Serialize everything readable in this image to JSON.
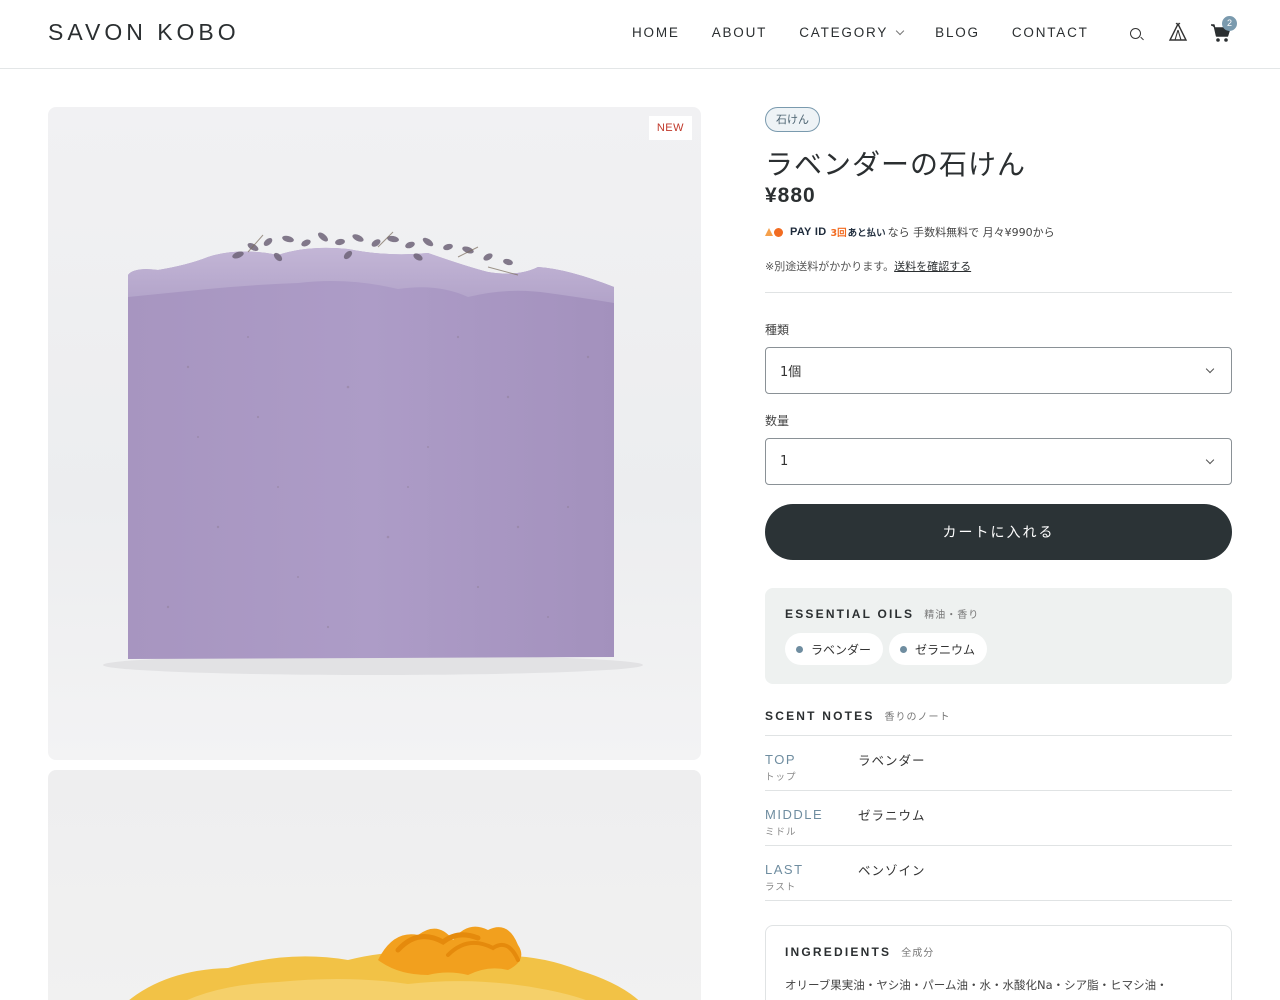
{
  "header": {
    "logo": "SAVON KOBO",
    "nav": [
      {
        "label": "HOME"
      },
      {
        "label": "ABOUT"
      },
      {
        "label": "CATEGORY"
      },
      {
        "label": "BLOG"
      },
      {
        "label": "CONTACT"
      }
    ],
    "cart_count": "2",
    "icons": [
      "search-icon",
      "tent-icon",
      "cart-icon"
    ]
  },
  "gallery": {
    "new_badge": "NEW"
  },
  "product": {
    "tag": "石けん",
    "title": "ラベンダーの石けん",
    "price": "¥880",
    "payid": {
      "brand": "PAY ID",
      "promo_a": "3回",
      "promo_b": "あと払い",
      "text": "なら 手数料無料で 月々¥990から"
    },
    "shipping": {
      "text": "※別途送料がかかります。",
      "link": "送料を確認する"
    },
    "type_field": {
      "label": "種類",
      "value": "1個"
    },
    "qty_field": {
      "label": "数量",
      "value": "1"
    },
    "cart_button": "カートに入れる"
  },
  "essential_oils": {
    "title": "ESSENTIAL OILS",
    "subtitle": "精油・香り",
    "items": [
      "ラベンダー",
      "ゼラニウム"
    ]
  },
  "scent_notes": {
    "title": "SCENT NOTES",
    "subtitle": "香りのノート",
    "rows": [
      {
        "en": "TOP",
        "jp": "トップ",
        "value": "ラベンダー"
      },
      {
        "en": "MIDDLE",
        "jp": "ミドル",
        "value": "ゼラニウム"
      },
      {
        "en": "LAST",
        "jp": "ラスト",
        "value": "ベンゾイン"
      }
    ]
  },
  "ingredients": {
    "title": "INGREDIENTS",
    "subtitle": "全成分",
    "text": "オリーブ果実油・ヤシ油・パーム油・水・水酸化Na・シア脂・ヒマシ油・"
  },
  "colors": {
    "accent": "#7a9aae",
    "dark_button": "#2b3336",
    "new_badge": "#c0392b"
  }
}
